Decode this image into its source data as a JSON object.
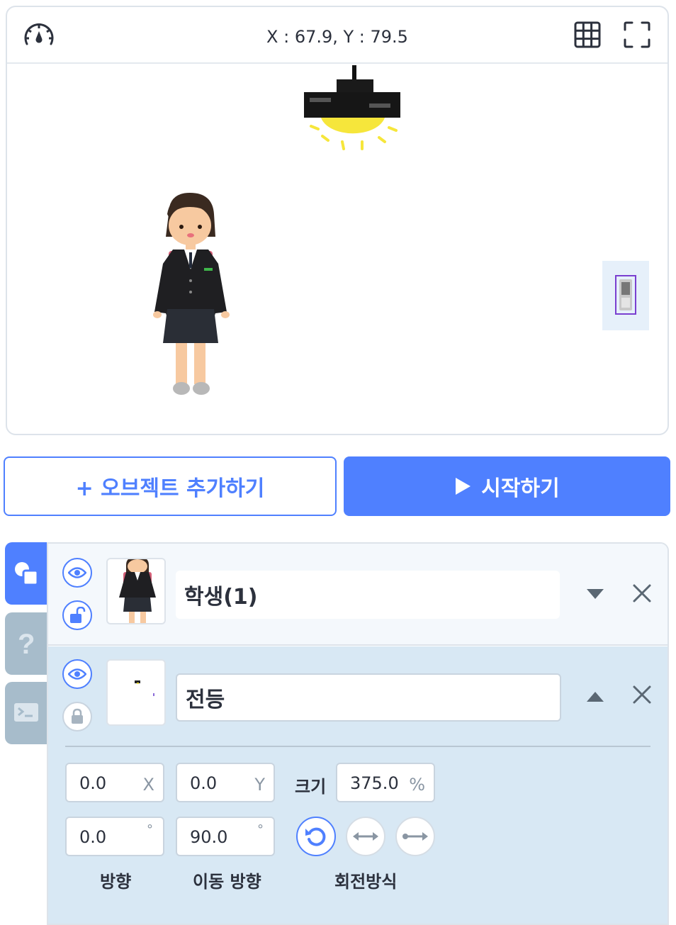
{
  "stage": {
    "coordinates": "X : 67.9, Y : 79.5",
    "icons": {
      "speed": "speedometer-icon",
      "grid": "grid-icon",
      "fullscreen": "fullscreen-icon"
    }
  },
  "buttons": {
    "add_object": "+ 오브젝트 추가하기",
    "start": "시작하기"
  },
  "colors": {
    "accent": "#4f80ff",
    "selected_bg": "#d8e8f4",
    "tab_inactive": "#a7bccb"
  },
  "objects": [
    {
      "name": "학생(1)",
      "visible": true,
      "locked": false,
      "expanded": false
    },
    {
      "name": "전등",
      "visible": true,
      "locked": true,
      "expanded": true
    }
  ],
  "properties": {
    "x": {
      "value": "0.0",
      "unit": "X"
    },
    "y": {
      "value": "0.0",
      "unit": "Y"
    },
    "size_label": "크기",
    "size": {
      "value": "375.0",
      "unit": "%"
    },
    "direction": {
      "value": "0.0",
      "unit": "°"
    },
    "move_direction": {
      "value": "90.0",
      "unit": "°"
    },
    "direction_label": "방향",
    "move_direction_label": "이동 방향",
    "rotation_label": "회전방식"
  }
}
